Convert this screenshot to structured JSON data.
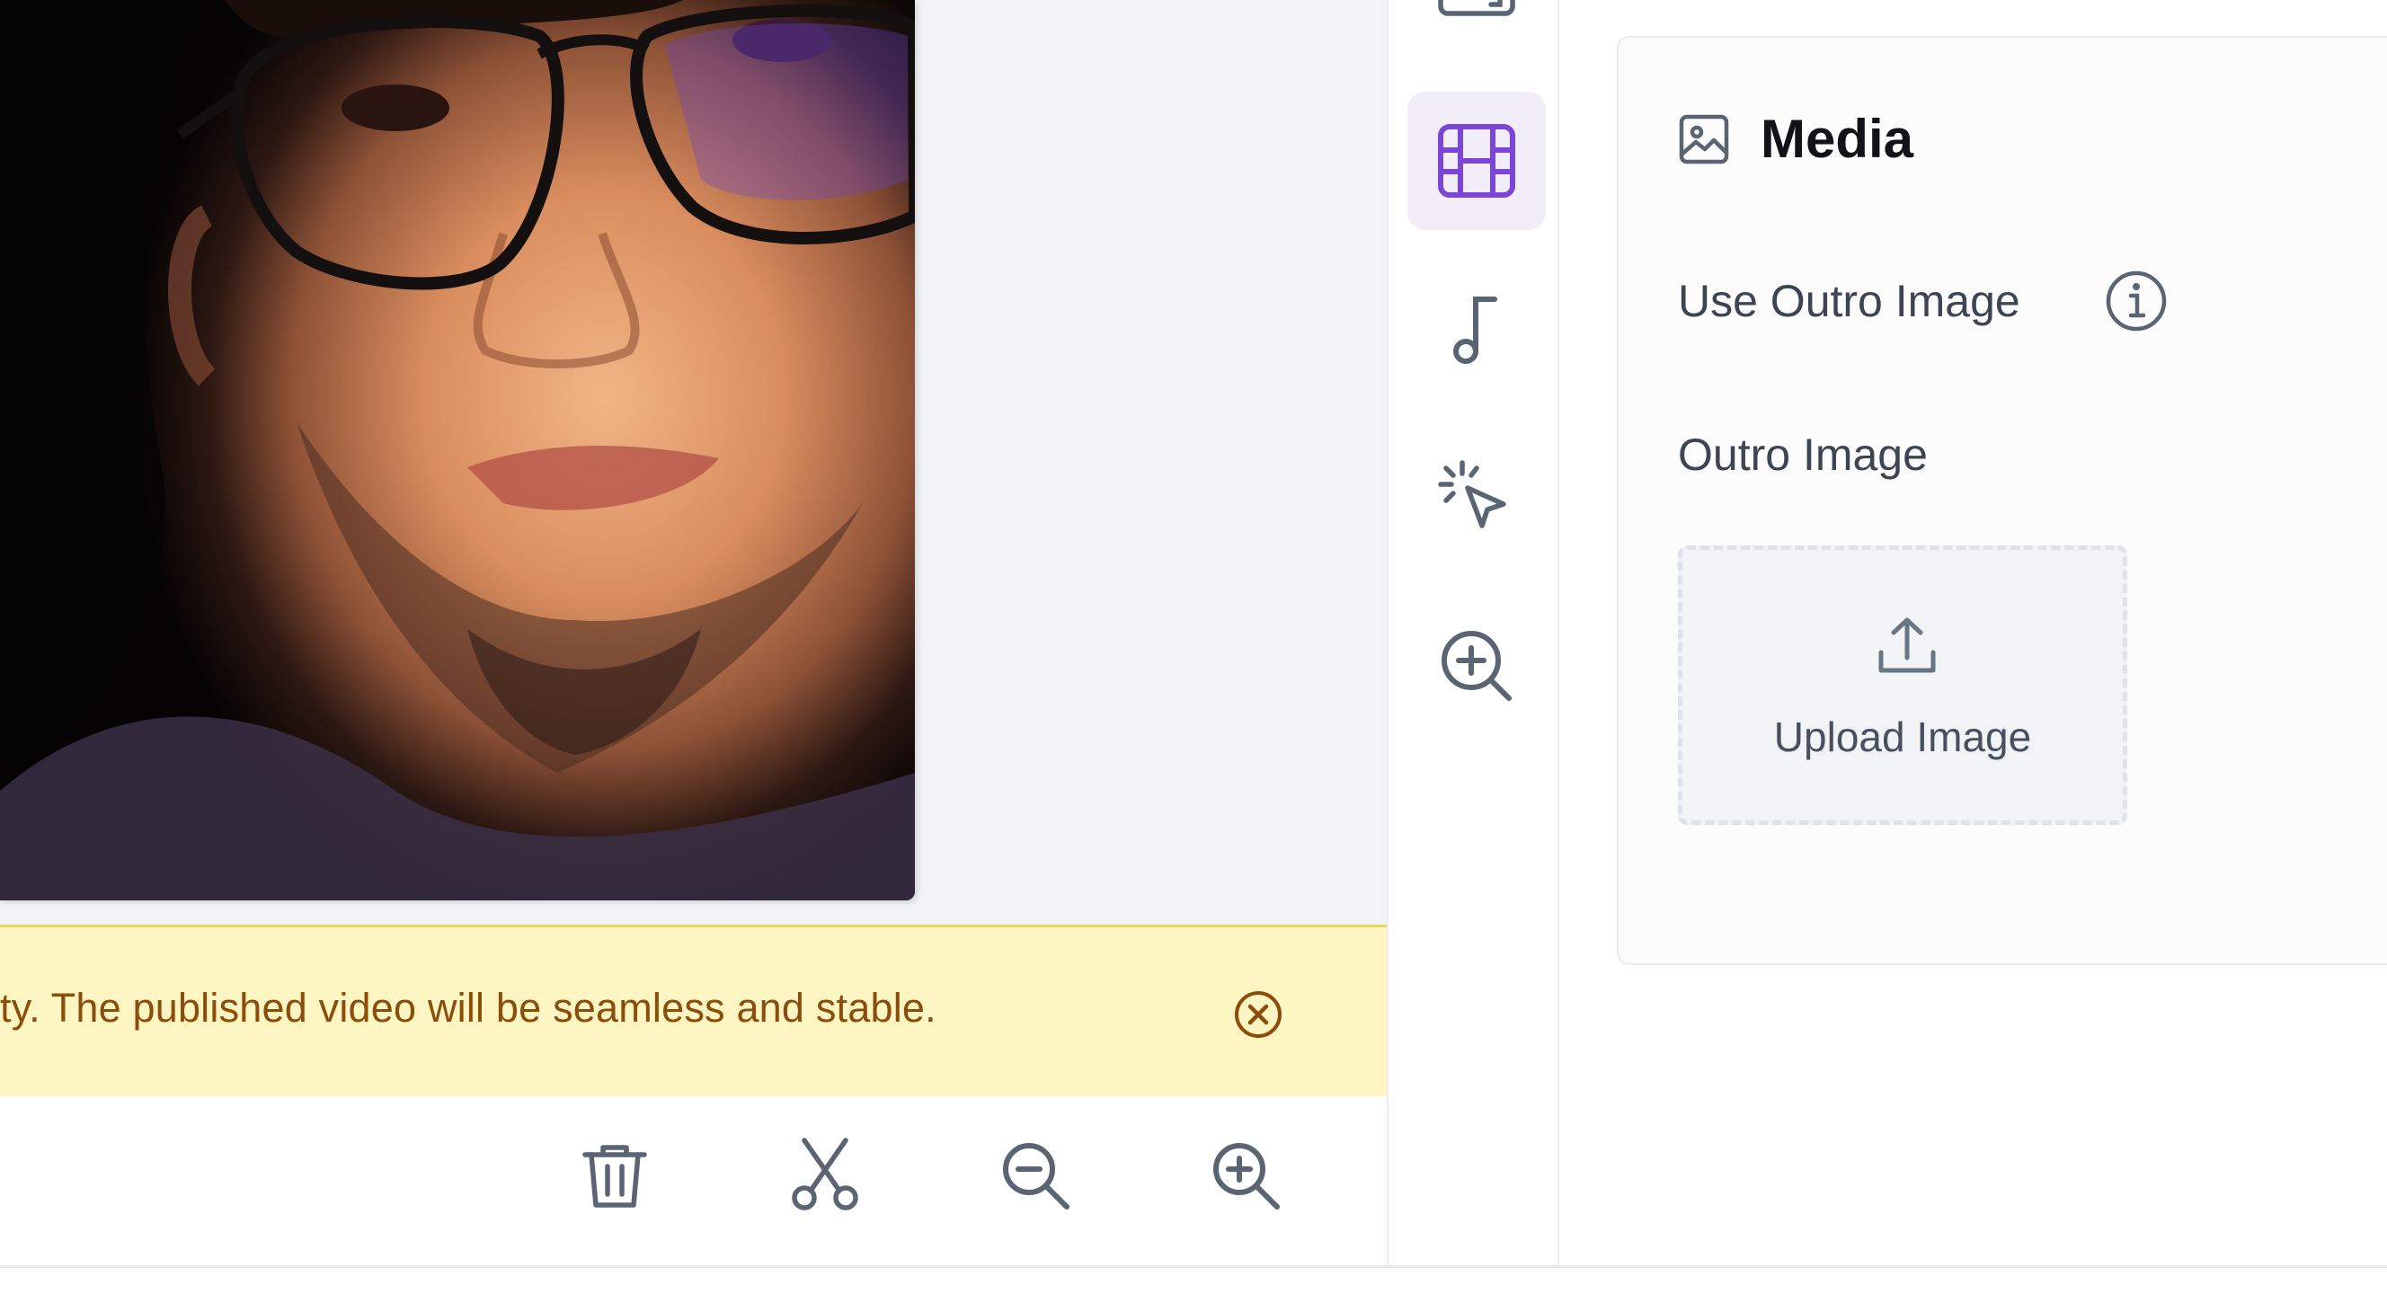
{
  "banner": {
    "message": "ty. The published video will be seamless and stable.",
    "close_icon": "close-circle-icon",
    "background": "#fdf5c2",
    "text_color": "#8c4d0b"
  },
  "toolbar": {
    "tools": [
      {
        "name": "delete",
        "icon": "trash-icon"
      },
      {
        "name": "split",
        "icon": "scissors-icon"
      },
      {
        "name": "zoom-out",
        "icon": "zoom-out-icon"
      },
      {
        "name": "zoom-in",
        "icon": "zoom-in-icon"
      }
    ]
  },
  "rail": {
    "items": [
      {
        "name": "template",
        "icon": "template-icon",
        "active": false
      },
      {
        "name": "media",
        "icon": "film-icon",
        "active": true
      },
      {
        "name": "music",
        "icon": "music-note-icon",
        "active": false
      },
      {
        "name": "effects",
        "icon": "cursor-click-icon",
        "active": false
      },
      {
        "name": "zoom",
        "icon": "zoom-in-icon",
        "active": false
      }
    ],
    "accent": "#7c45d6"
  },
  "panel": {
    "title": "Media",
    "title_icon": "image-icon",
    "use_outro_label": "Use Outro Image",
    "info_icon": "info-icon",
    "outro_label": "Outro Image",
    "upload_label": "Upload Image",
    "upload_icon": "upload-icon"
  }
}
